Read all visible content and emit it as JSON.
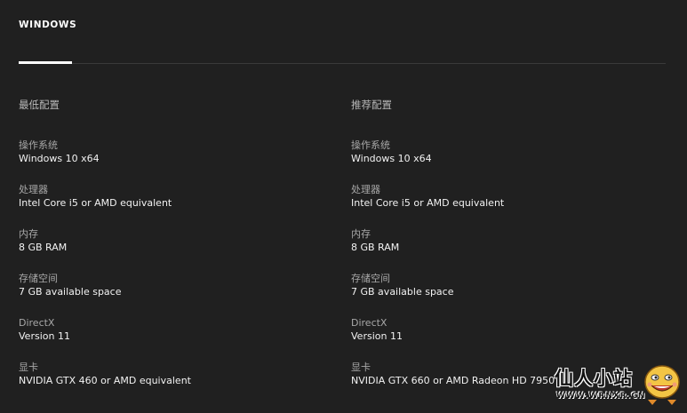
{
  "tab": {
    "label": "WINDOWS"
  },
  "columns": [
    {
      "heading": "最低配置",
      "specs": [
        {
          "label": "操作系统",
          "value": "Windows 10 x64"
        },
        {
          "label": "处理器",
          "value": "Intel Core i5 or AMD equivalent"
        },
        {
          "label": "内存",
          "value": "8 GB RAM"
        },
        {
          "label": "存储空间",
          "value": "7 GB available space"
        },
        {
          "label": "DirectX",
          "value": "Version 11"
        },
        {
          "label": "显卡",
          "value": "NVIDIA GTX 460 or AMD equivalent"
        }
      ]
    },
    {
      "heading": "推荐配置",
      "specs": [
        {
          "label": "操作系统",
          "value": "Windows 10 x64"
        },
        {
          "label": "处理器",
          "value": "Intel Core i5 or AMD equivalent"
        },
        {
          "label": "内存",
          "value": "8 GB RAM"
        },
        {
          "label": "存储空间",
          "value": "7 GB available space"
        },
        {
          "label": "DirectX",
          "value": "Version 11"
        },
        {
          "label": "显卡",
          "value": "NVIDIA GTX 660 or AMD Radeon HD 7950"
        }
      ]
    }
  ],
  "watermark": {
    "title": "仙人小站",
    "subtitle": "WWW.WRNXR.CN",
    "icon": "smiley-face-icon"
  },
  "colors": {
    "background": "#202020",
    "text_primary": "#f2f2f2",
    "text_secondary": "#a8a8a8",
    "divider": "#3a3a3a",
    "tab_underline": "#ffffff"
  }
}
